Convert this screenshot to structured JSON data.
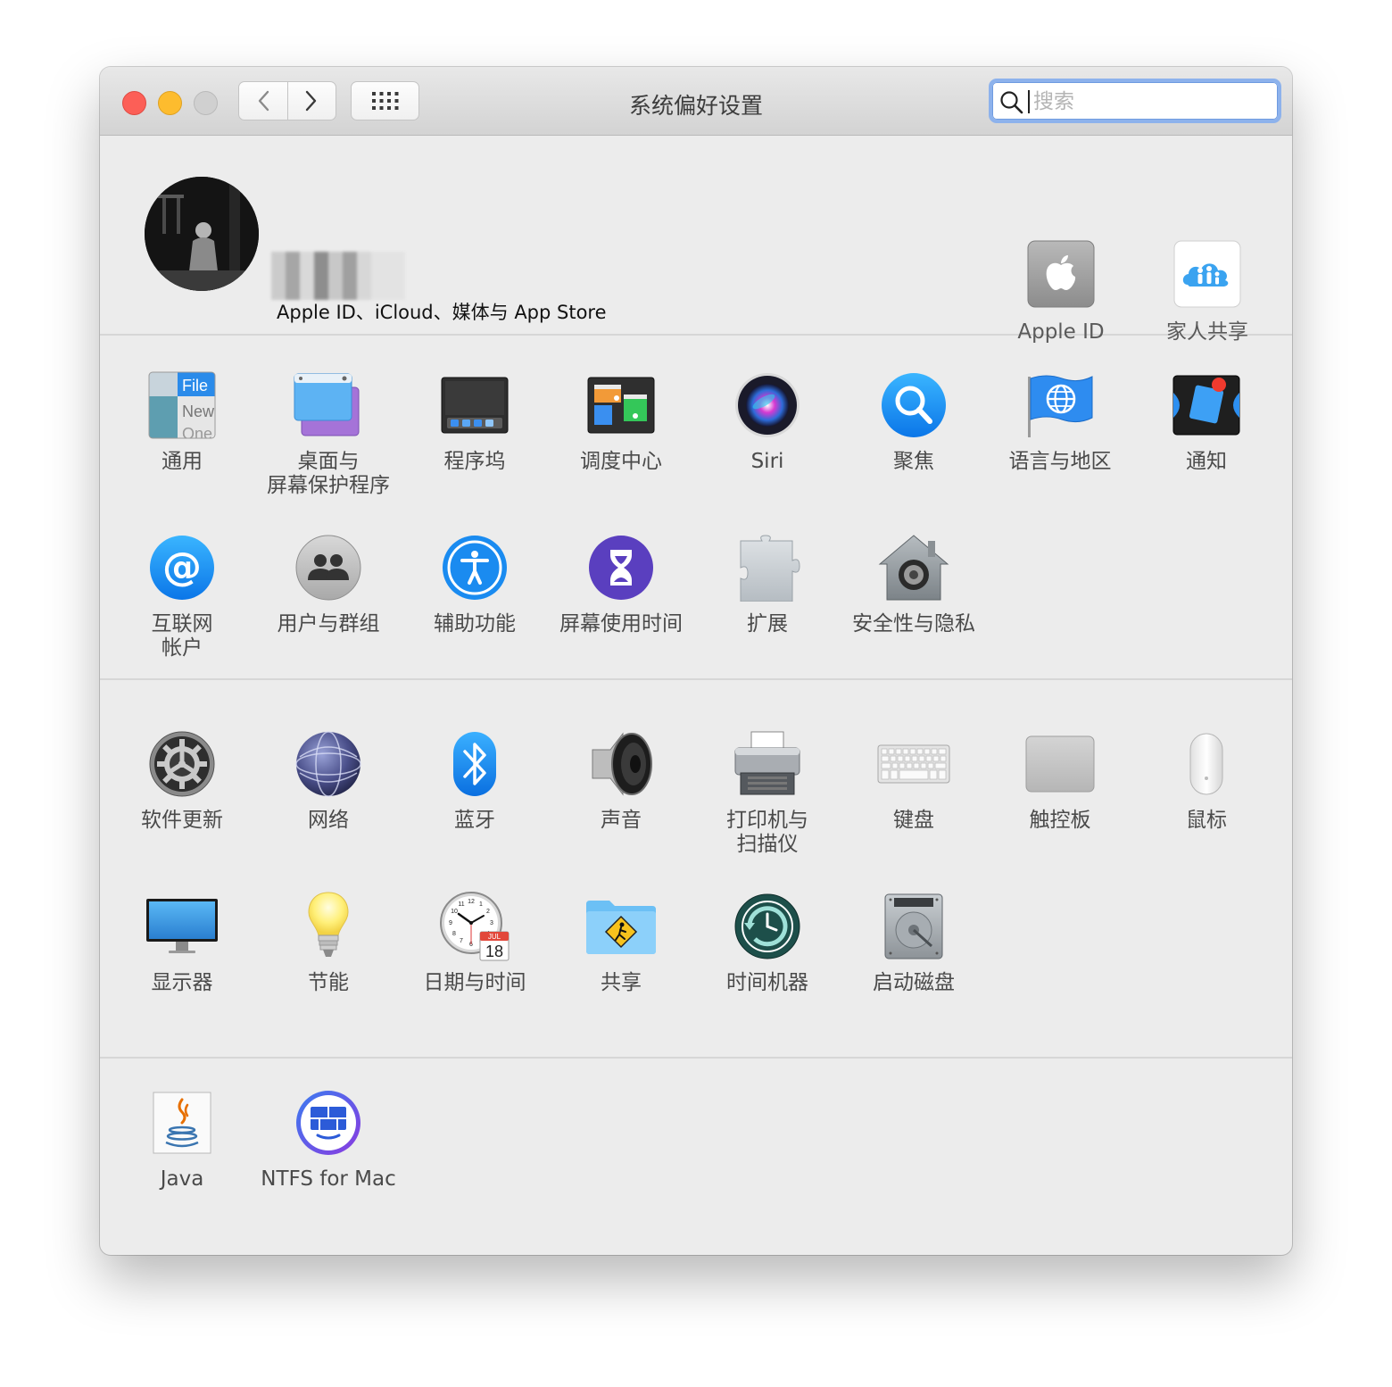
{
  "window": {
    "title": "系统偏好设置",
    "search_placeholder": "搜索"
  },
  "apple_account": {
    "caption": "Apple ID、iCloud、媒体与 App Store",
    "items": [
      {
        "label": "Apple ID",
        "icon": "apple-logo-icon"
      },
      {
        "label": "家人共享",
        "icon": "family-cloud-icon"
      }
    ]
  },
  "sections": [
    {
      "rows": [
        [
          {
            "label": "通用",
            "icon": "general-icon"
          },
          {
            "label": "桌面与\n屏幕保护程序",
            "icon": "desktop-icon"
          },
          {
            "label": "程序坞",
            "icon": "dock-icon"
          },
          {
            "label": "调度中心",
            "icon": "mission-control-icon"
          },
          {
            "label": "Siri",
            "icon": "siri-icon"
          },
          {
            "label": "聚焦",
            "icon": "spotlight-icon"
          },
          {
            "label": "语言与地区",
            "icon": "globe-flag-icon"
          },
          {
            "label": "通知",
            "icon": "notifications-icon"
          }
        ],
        [
          {
            "label": "互联网\n帐户",
            "icon": "at-sign-icon"
          },
          {
            "label": "用户与群组",
            "icon": "users-icon"
          },
          {
            "label": "辅助功能",
            "icon": "accessibility-icon"
          },
          {
            "label": "屏幕使用时间",
            "icon": "hourglass-icon"
          },
          {
            "label": "扩展",
            "icon": "puzzle-icon"
          },
          {
            "label": "安全性与隐私",
            "icon": "security-house-icon"
          }
        ]
      ]
    },
    {
      "rows": [
        [
          {
            "label": "软件更新",
            "icon": "gear-icon"
          },
          {
            "label": "网络",
            "icon": "network-globe-icon"
          },
          {
            "label": "蓝牙",
            "icon": "bluetooth-icon"
          },
          {
            "label": "声音",
            "icon": "speaker-icon"
          },
          {
            "label": "打印机与\n扫描仪",
            "icon": "printer-icon"
          },
          {
            "label": "键盘",
            "icon": "keyboard-icon"
          },
          {
            "label": "触控板",
            "icon": "trackpad-icon"
          },
          {
            "label": "鼠标",
            "icon": "mouse-icon"
          }
        ],
        [
          {
            "label": "显示器",
            "icon": "display-icon"
          },
          {
            "label": "节能",
            "icon": "lightbulb-icon"
          },
          {
            "label": "日期与时间",
            "icon": "clock-calendar-icon"
          },
          {
            "label": "共享",
            "icon": "sharing-folder-icon"
          },
          {
            "label": "时间机器",
            "icon": "time-machine-icon"
          },
          {
            "label": "启动磁盘",
            "icon": "hard-disk-icon"
          }
        ]
      ]
    },
    {
      "rows": [
        [
          {
            "label": "Java",
            "icon": "java-icon"
          },
          {
            "label": "NTFS for Mac",
            "icon": "ntfs-icon"
          }
        ]
      ]
    }
  ],
  "icon_text": {
    "general": [
      "File",
      "New",
      "One"
    ],
    "calendar_month": "JUL",
    "calendar_day": "18",
    "clock_numbers": [
      "12",
      "1",
      "2",
      "3",
      "4",
      "5",
      "6",
      "7",
      "8",
      "9",
      "10",
      "11"
    ]
  }
}
